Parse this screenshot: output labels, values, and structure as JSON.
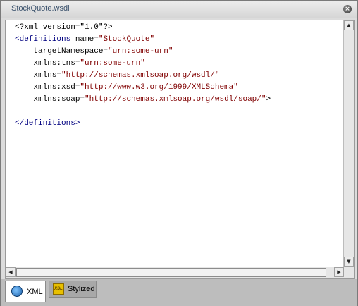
{
  "window": {
    "title": "StockQuote.wsdl",
    "close_label": "×"
  },
  "editor": {
    "lines": [
      {
        "segments": [
          {
            "t": "<?xml version=\"1.0\"?>",
            "c": "pi"
          }
        ]
      },
      {
        "segments": [
          {
            "t": "<",
            "c": "tag"
          },
          {
            "t": "definitions",
            "c": "tag"
          },
          {
            "t": " name=",
            "c": "attr"
          },
          {
            "t": "\"StockQuote\"",
            "c": "val"
          }
        ]
      },
      {
        "segments": [
          {
            "t": "    targetNamespace=",
            "c": "attr"
          },
          {
            "t": "\"urn:some-urn\"",
            "c": "val"
          }
        ]
      },
      {
        "segments": [
          {
            "t": "    xmlns:tns=",
            "c": "attr"
          },
          {
            "t": "\"urn:some-urn\"",
            "c": "val"
          }
        ]
      },
      {
        "segments": [
          {
            "t": "    xmlns=",
            "c": "attr"
          },
          {
            "t": "\"http://schemas.xmlsoap.org/wsdl/\"",
            "c": "val"
          }
        ]
      },
      {
        "segments": [
          {
            "t": "    xmlns:xsd=",
            "c": "attr"
          },
          {
            "t": "\"http://www.w3.org/1999/XMLSchema\"",
            "c": "val"
          }
        ]
      },
      {
        "segments": [
          {
            "t": "    xmlns:soap=",
            "c": "attr"
          },
          {
            "t": "\"http://schemas.xmlsoap.org/wsdl/soap/\"",
            "c": "val"
          },
          {
            "t": ">",
            "c": "attr"
          }
        ]
      },
      {
        "segments": [
          {
            "t": "",
            "c": "attr"
          }
        ]
      },
      {
        "segments": [
          {
            "t": "</",
            "c": "tag"
          },
          {
            "t": "definitions",
            "c": "tag"
          },
          {
            "t": ">",
            "c": "tag"
          }
        ]
      }
    ]
  },
  "scrollbars": {
    "up": "▲",
    "down": "▼",
    "left": "◀",
    "right": "▶"
  },
  "tabs": [
    {
      "label": "XML",
      "icon": "globe-icon",
      "active": true
    },
    {
      "label": "Stylized",
      "icon": "xsl-icon",
      "active": false,
      "icon_text": "XSL"
    }
  ]
}
